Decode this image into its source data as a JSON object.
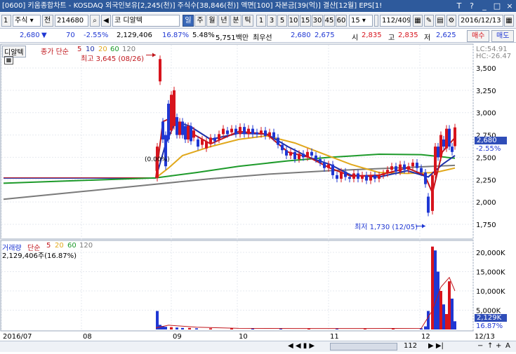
{
  "window": {
    "title": "[0600] 키움종합차트 - KOSDAQ 외국인보유[2,245(천)] 주식수[38,846(천)] 액면[100] 자본금[39(억)] 결산[12월] EPS[1!",
    "controls": [
      "T",
      "?",
      "_",
      "□",
      "×"
    ]
  },
  "toolbar": {
    "num": "1",
    "market": "주식",
    "prev_label": "전",
    "code": "214680",
    "stock_name": "코 디알텍",
    "periods": [
      "일",
      "주",
      "월",
      "년",
      "분",
      "틱"
    ],
    "minutes": [
      "1",
      "3",
      "5",
      "10",
      "15",
      "30",
      "45",
      "60"
    ],
    "minute_select": "15",
    "count": "112",
    "count_total": "/409",
    "date": "2016/12/13"
  },
  "quote": {
    "price": "2,680",
    "change": "70",
    "change_pct": "-2.55%",
    "volume": "2,129,406",
    "volume_ratio": "16.87%",
    "turnover": "5.48%",
    "amount": "5,751백만",
    "pref_label": "최우선",
    "best_ask": "2,680",
    "best_bid": "2,675",
    "open_label": "시",
    "open": "2,835",
    "high_label": "고",
    "high": "2,835",
    "low_label": "저",
    "low": "2,625",
    "buy_label": "매수",
    "sell_label": "매도"
  },
  "price_panel": {
    "stock_tag": "디알텍",
    "indicator_label": "종가 단순",
    "ma_periods": [
      "5",
      "10",
      "20",
      "60",
      "120"
    ],
    "ma_colors": [
      "#c0161c",
      "#1c2fa8",
      "#e1a81c",
      "#1d9a2a",
      "#7a7a7a"
    ],
    "high_note": "최고 3,645 (08/26)",
    "low_note": "최저 1,730 (12/05)",
    "start_note": "(0.00%)",
    "lc": "LC:54.91",
    "hc": "HC:-26.47",
    "current_price": "2,680",
    "current_change": "-2.55%"
  },
  "volume_panel": {
    "label": "거래량",
    "indicator_label": "단순",
    "ma_periods": [
      "5",
      "20",
      "60",
      "120"
    ],
    "value_text": "2,129,406주(16.87%)",
    "current_value": "2,129K",
    "current_pct": "16.87%"
  },
  "chart_data": {
    "type": "candlestick",
    "price_axis": {
      "ticks": [
        1750,
        2000,
        2250,
        2500,
        2750,
        3000,
        3250,
        3500
      ],
      "tick_labels": [
        "1,750",
        "2,000",
        "2,250",
        "2,500",
        "2,750",
        "3,000",
        "3,250",
        "3,500"
      ]
    },
    "volume_axis": {
      "ticks": [
        5000,
        10000,
        15000,
        20000
      ],
      "tick_labels": [
        "5,000K",
        "10,000K",
        "15,000K",
        "20,000K"
      ],
      "unit": "K"
    },
    "x_labels": [
      "2016/07",
      "08",
      "09",
      "10",
      "11",
      "12",
      "12/13"
    ],
    "high_mark": 3645,
    "low_mark": 1730,
    "current": 2680
  },
  "bottom": {
    "scroll_count": "112",
    "zoom_minus": "−",
    "zoom_plus": "+",
    "scale_label": "A"
  }
}
